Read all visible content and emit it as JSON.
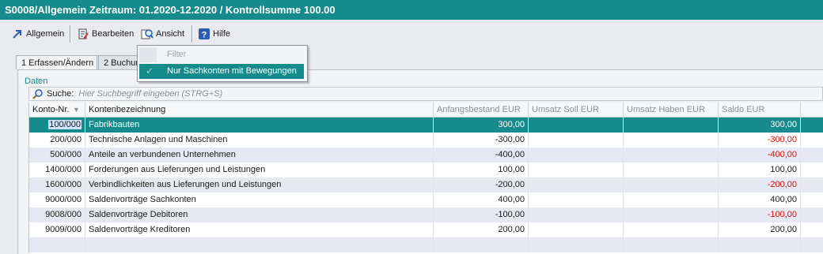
{
  "window": {
    "title": "S0008/Allgemein Zeitraum: 01.2020-12.2020 / Kontrollsumme 100.00"
  },
  "toolbar": {
    "allgemein": {
      "label": "Allgemein",
      "icon": "arrow-up-right-icon"
    },
    "bearbeiten": {
      "label": "Bearbeiten",
      "icon": "edit-document-icon"
    },
    "ansicht": {
      "label": "Ansicht",
      "icon": "magnifier-view-icon"
    },
    "hilfe": {
      "label": "Hilfe",
      "icon": "help-icon"
    }
  },
  "tabs": [
    {
      "label": "1 Erfassen/Ändern"
    },
    {
      "label": "2 Buchun"
    }
  ],
  "menu": {
    "items": [
      {
        "label": "Filter",
        "enabled": false,
        "checked": false
      },
      {
        "label": "Nur Sachkonten mit Bewegungen",
        "enabled": true,
        "checked": true,
        "highlighted": true
      }
    ]
  },
  "panel": {
    "legend": "Daten"
  },
  "search": {
    "label": "Suche:",
    "placeholder": "Hier Suchbegriff eingeben (STRG+S)"
  },
  "table": {
    "columns": [
      {
        "label": "Konto-Nr.",
        "sort_icon": "sort-down-icon"
      },
      {
        "label": "Kontenbezeichnung"
      },
      {
        "label": "Anfangsbestand EUR"
      },
      {
        "label": "Umsatz Soll EUR"
      },
      {
        "label": "Umsatz Haben EUR"
      },
      {
        "label": "Saldo EUR"
      }
    ],
    "rows": [
      {
        "konto": "100/000",
        "bez": "Fabrikbauten",
        "anfang": "300,00",
        "soll": "",
        "haben": "",
        "saldo": "300,00",
        "saldo_neg": false,
        "selected": true
      },
      {
        "konto": "200/000",
        "bez": "Technische Anlagen und Maschinen",
        "anfang": "-300,00",
        "soll": "",
        "haben": "",
        "saldo": "-300,00",
        "saldo_neg": true
      },
      {
        "konto": "500/000",
        "bez": "Anteile an verbundenen Unternehmen",
        "anfang": "-400,00",
        "soll": "",
        "haben": "",
        "saldo": "-400,00",
        "saldo_neg": true
      },
      {
        "konto": "1400/000",
        "bez": "Forderungen aus Lieferungen und Leistungen",
        "anfang": "100,00",
        "soll": "",
        "haben": "",
        "saldo": "100,00",
        "saldo_neg": false
      },
      {
        "konto": "1600/000",
        "bez": "Verbindlichkeiten aus Lieferungen und Leistungen",
        "anfang": "-200,00",
        "soll": "",
        "haben": "",
        "saldo": "-200,00",
        "saldo_neg": true
      },
      {
        "konto": "9000/000",
        "bez": "Saldenvorträge Sachkonten",
        "anfang": "400,00",
        "soll": "",
        "haben": "",
        "saldo": "400,00",
        "saldo_neg": false
      },
      {
        "konto": "9008/000",
        "bez": "Saldenvorträge Debitoren",
        "anfang": "-100,00",
        "soll": "",
        "haben": "",
        "saldo": "-100,00",
        "saldo_neg": true
      },
      {
        "konto": "9009/000",
        "bez": "Saldenvorträge Kreditoren",
        "anfang": "200,00",
        "soll": "",
        "haben": "",
        "saldo": "200,00",
        "saldo_neg": false
      }
    ]
  },
  "colors": {
    "accent": "#168b8c",
    "negative": "#d01010",
    "row_alt": "#e6e9f1"
  }
}
